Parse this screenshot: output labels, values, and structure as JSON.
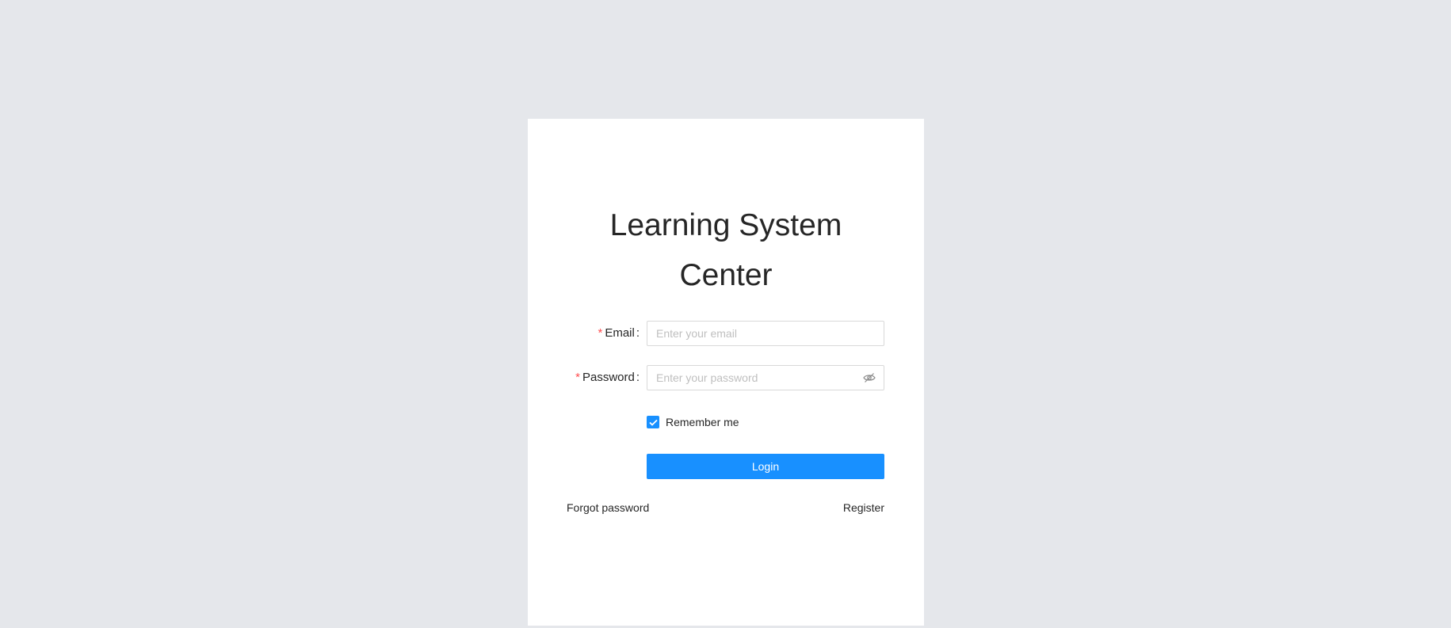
{
  "login": {
    "title_line1": "Learning System",
    "title_line2": "Center",
    "email": {
      "label": "Email",
      "required_mark": "*",
      "placeholder": "Enter your email",
      "value": ""
    },
    "password": {
      "label": "Password",
      "required_mark": "*",
      "placeholder": "Enter your password",
      "value": "",
      "visibility_icon": "eye-invisible-icon"
    },
    "remember": {
      "label": "Remember me",
      "checked": true
    },
    "login_button": "Login",
    "forgot_password": "Forgot password",
    "register": "Register"
  },
  "colors": {
    "background": "#e5e7eb",
    "primary": "#1890ff",
    "required": "#ff4d4f"
  }
}
